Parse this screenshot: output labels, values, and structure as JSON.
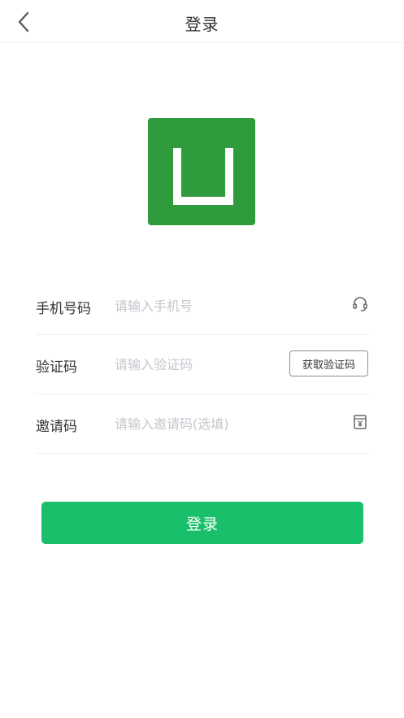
{
  "header": {
    "title": "登录",
    "back_icon": "chevron-left-icon"
  },
  "logo": {
    "color": "#2f9b3d",
    "icon": "logo-mark"
  },
  "form": {
    "phone": {
      "label": "手机号码",
      "placeholder": "请输入手机号",
      "icon": "headset-icon"
    },
    "code": {
      "label": "验证码",
      "placeholder": "请输入验证码",
      "button_label": "获取验证码"
    },
    "invite": {
      "label": "邀请码",
      "placeholder": "请输入邀请码(选填)",
      "icon": "yen-box-icon"
    }
  },
  "login_button": {
    "label": "登录",
    "color": "#1abf6b"
  }
}
